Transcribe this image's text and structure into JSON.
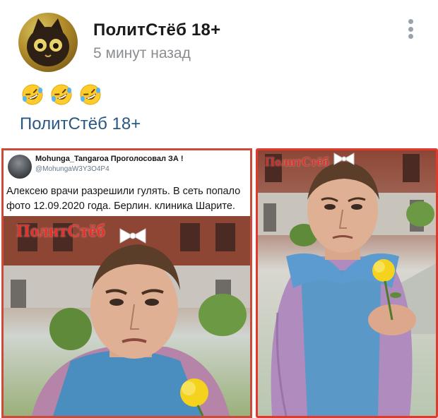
{
  "post": {
    "author": "ПолитСтёб 18+",
    "time": "5 минут назад",
    "emojis": [
      "rofl-emoji",
      "rofl-emoji",
      "rofl-emoji"
    ],
    "hashtag_link": "ПолитСтёб 18+"
  },
  "tweet": {
    "name": "Mohunga_Tangaroa Проголосовал ЗА !",
    "handle": "@MohungaW3Y3O4P4",
    "text": "Алексею врачи разрешили гулять. В сеть попало фото 12.09.2020 года. Берлин. клиника Шарите."
  },
  "watermark": "ПолитСтёб",
  "colors": {
    "link": "#2a5885",
    "muted": "#8a8d91",
    "frame_left": "#c94b3b",
    "frame_right": "#e03a2f",
    "watermark": "#e8312b"
  }
}
